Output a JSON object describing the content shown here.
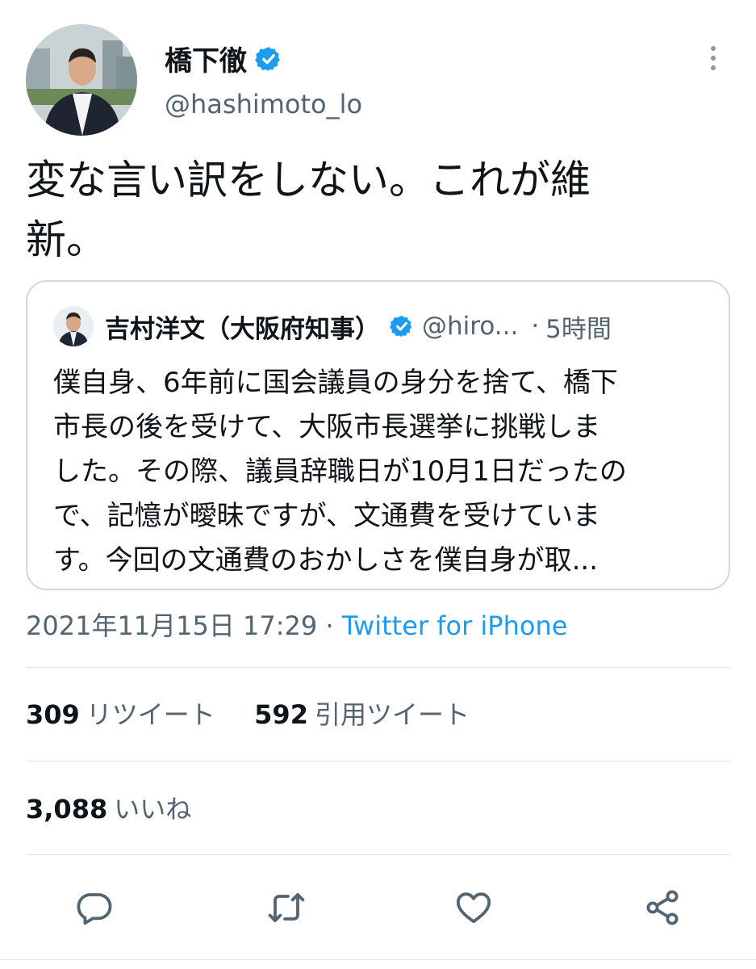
{
  "author": {
    "display_name": "橋下徹",
    "handle": "@hashimoto_lo",
    "verified": true
  },
  "tweet": {
    "text_line1": "変な言い訳をしない。これが維",
    "text_line2": "新。"
  },
  "quoted": {
    "display_name": "吉村洋文（大阪府知事）",
    "handle": "@hiro...",
    "separator": "·",
    "time": "5時間",
    "lines": [
      "僕自身、6年前に国会議員の身分を捨て、橋下",
      "市長の後を受けて、大阪市長選挙に挑戦しま",
      "した。その際、議員辞職日が10月1日だったの",
      "で、記憶が曖昧ですが、文通費を受けていま",
      "す。今回の文通費のおかしさを僕自身が取..."
    ]
  },
  "meta": {
    "datetime": "2021年11月15日 17:29",
    "separator": "·",
    "source": "Twitter for iPhone"
  },
  "stats": {
    "retweets_count": "309",
    "retweets_label": "リツイート",
    "quotes_count": "592",
    "quotes_label": "引用ツイート",
    "likes_count": "3,088",
    "likes_label": "いいね"
  },
  "actions": [
    "reply-icon",
    "retweet-icon",
    "like-icon",
    "share-icon"
  ],
  "colors": {
    "accent": "#1d9bf0",
    "text": "#0f1419",
    "secondary": "#536471",
    "border": "#cfd9de"
  }
}
